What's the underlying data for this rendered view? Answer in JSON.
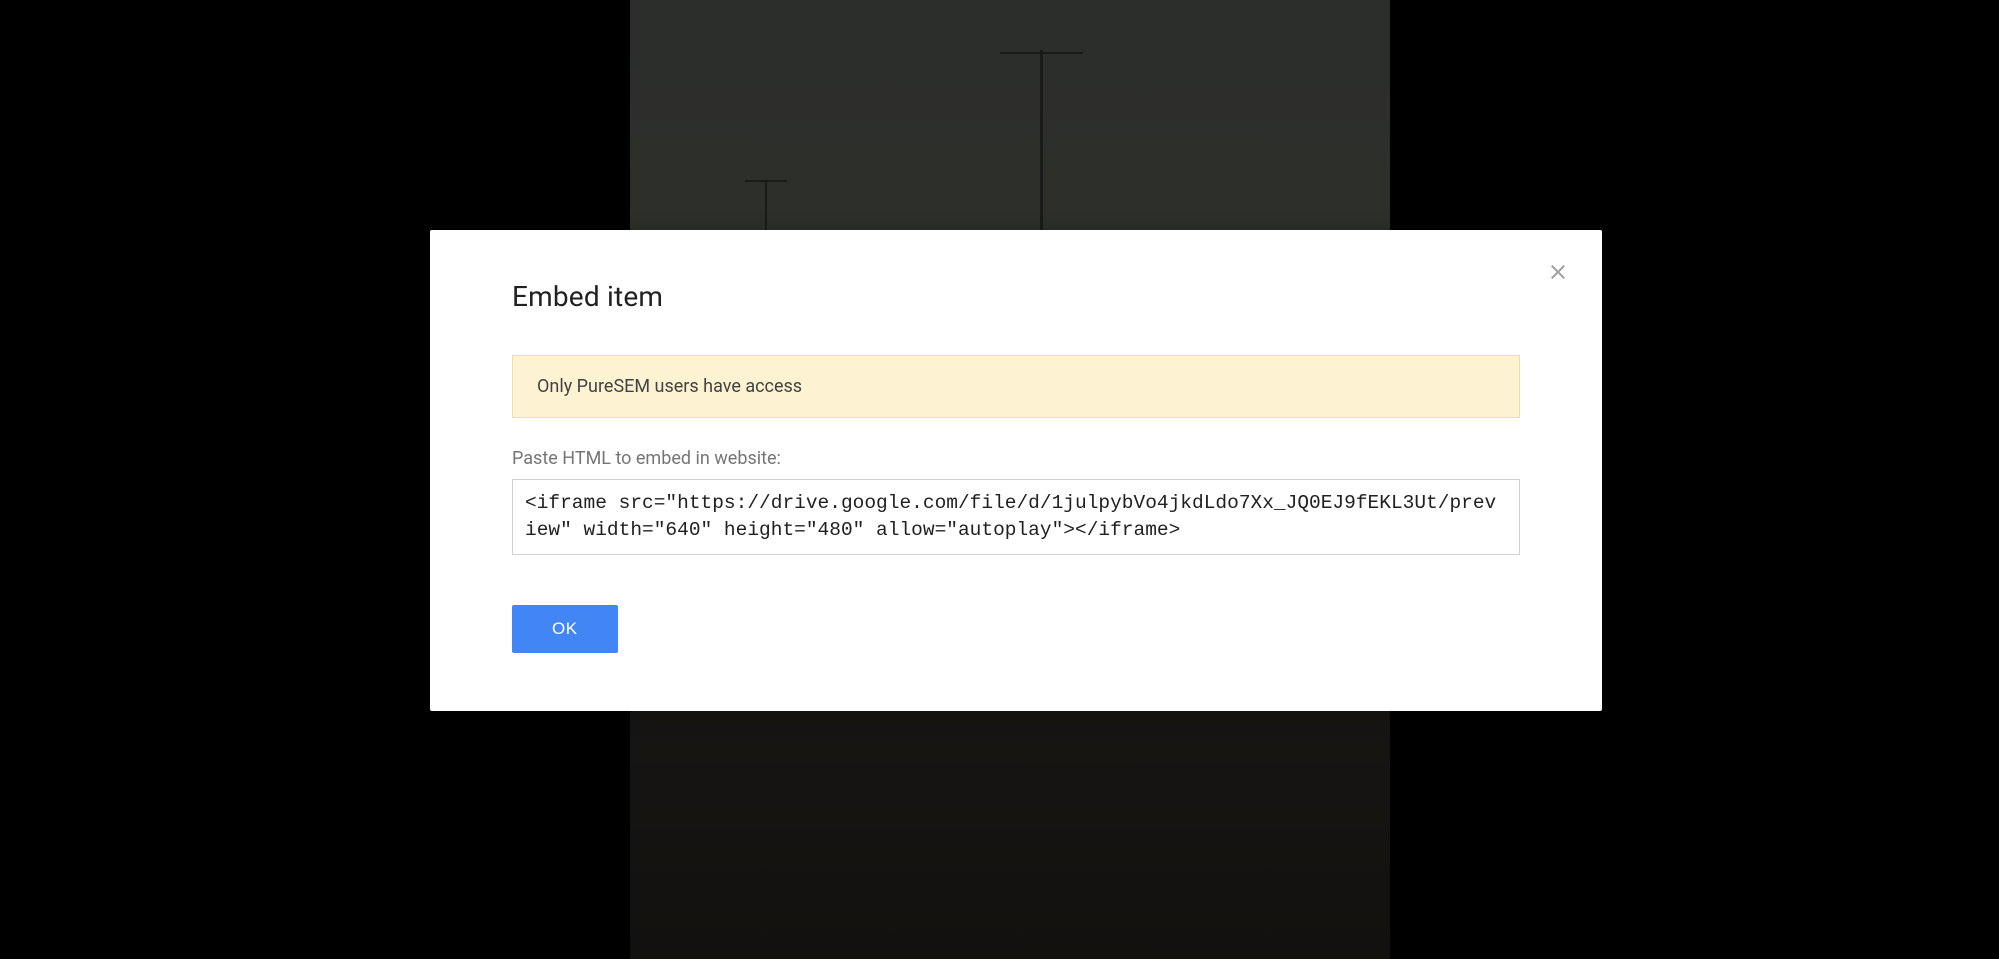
{
  "modal": {
    "title": "Embed item",
    "warning_message": "Only PureSEM users have access",
    "paste_label": "Paste HTML to embed in website:",
    "embed_code": "<iframe src=\"https://drive.google.com/file/d/1julpybVo4jkdLdo7Xx_JQ0EJ9fEKL3Ut/preview\" width=\"640\" height=\"480\" allow=\"autoplay\"></iframe>",
    "ok_button_label": "OK"
  }
}
